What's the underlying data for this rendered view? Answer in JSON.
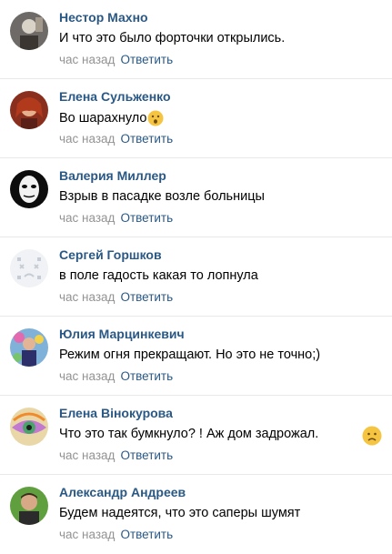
{
  "comments": [
    {
      "author": "Нестор Махно",
      "text": "И что это было форточки открылись.",
      "time": "час назад",
      "reply": "Ответить"
    },
    {
      "author": "Елена Сульженко",
      "text": "Во шарахнуло",
      "time": "час назад",
      "reply": "Ответить"
    },
    {
      "author": "Валерия Миллер",
      "text": "Взрыв в пасадке возле больницы",
      "time": "час назад",
      "reply": "Ответить"
    },
    {
      "author": "Сергей Горшков",
      "text": "в поле гадость какая то лопнула",
      "time": "час назад",
      "reply": "Ответить"
    },
    {
      "author": "Юлия Марцинкевич",
      "text": "Режим огня прекращают. Но это не точно;)",
      "time": "час назад",
      "reply": "Ответить"
    },
    {
      "author": "Елена Вiнокурова",
      "text": "Что это так бумкнуло? ! Аж дом задрожал.",
      "time": "час назад",
      "reply": "Ответить"
    },
    {
      "author": "Александр Андреев",
      "text": "Будем надеятся, что это саперы шумят",
      "time": "час назад",
      "reply": "Ответить"
    }
  ],
  "colors": {
    "link": "#2a5885",
    "meta": "#939393",
    "divider": "#e7e8ec",
    "emoji": "#f5c542"
  }
}
